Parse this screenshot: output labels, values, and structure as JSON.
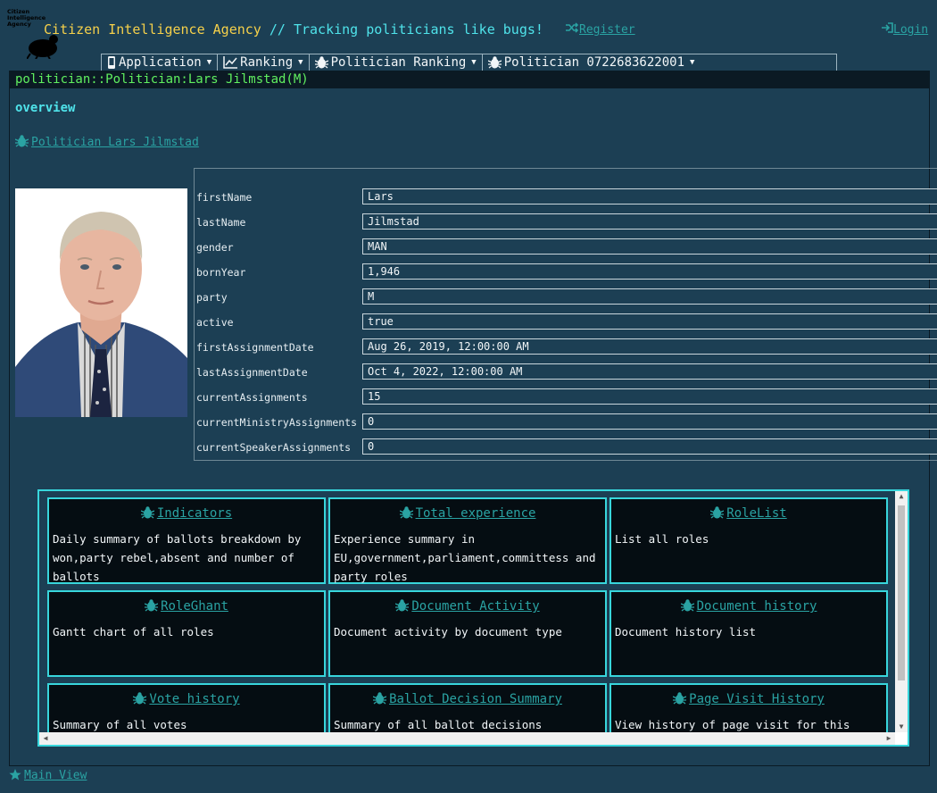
{
  "header": {
    "logo_text": "Citizen\nIntelligence\nAgency",
    "title_part1": "Citizen Intelligence Agency",
    "title_part2": " // Tracking politicians like bugs!",
    "register_label": "Register",
    "login_label": "Login"
  },
  "menu": [
    {
      "label": "Application",
      "icon": "phone-icon"
    },
    {
      "label": "Ranking",
      "icon": "line-chart-icon"
    },
    {
      "label": "Politician Ranking",
      "icon": "bug-icon"
    },
    {
      "label": "Politician 0722683622001",
      "icon": "bug-icon"
    }
  ],
  "page": {
    "title": "politician::Politician:Lars Jilmstad(M)",
    "section": "overview",
    "politician_link": "Politician Lars Jilmstad"
  },
  "attributes": [
    {
      "label": "firstName",
      "value": "Lars"
    },
    {
      "label": "lastName",
      "value": "Jilmstad"
    },
    {
      "label": "gender",
      "value": "MAN"
    },
    {
      "label": "bornYear",
      "value": "1,946"
    },
    {
      "label": "party",
      "value": "M"
    },
    {
      "label": "active",
      "value": "true"
    },
    {
      "label": "firstAssignmentDate",
      "value": "Aug 26, 2019, 12:00:00 AM"
    },
    {
      "label": "lastAssignmentDate",
      "value": "Oct 4, 2022, 12:00:00 AM"
    },
    {
      "label": "currentAssignments",
      "value": "15"
    },
    {
      "label": "currentMinistryAssignments",
      "value": "0"
    },
    {
      "label": "currentSpeakerAssignments",
      "value": "0"
    }
  ],
  "cards": [
    {
      "title": "Indicators",
      "desc": "Daily summary of ballots breakdown by won,party rebel,absent and number of ballots"
    },
    {
      "title": "Total experience",
      "desc": "Experience summary in EU,government,parliament,committess and party roles"
    },
    {
      "title": "RoleList",
      "desc": "List all roles"
    },
    {
      "title": "RoleGhant",
      "desc": "Gantt chart of all roles"
    },
    {
      "title": "Document Activity",
      "desc": "Document activity by document type"
    },
    {
      "title": "Document history",
      "desc": "Document history list"
    },
    {
      "title": "Vote history",
      "desc": "Summary of all votes"
    },
    {
      "title": "Ballot Decision Summary",
      "desc": "Summary of all ballot decisions"
    },
    {
      "title": "Page Visit History",
      "desc": "View history of page visit for this page."
    }
  ],
  "footer": {
    "main_view_label": "Main View"
  },
  "colors": {
    "background": "#1c3f54",
    "accent": "#2aa3a3",
    "title_yellow": "#f5d04a",
    "title_cyan": "#4fe3ea",
    "page_title_green": "#60f060",
    "card_border": "#38d6dc"
  }
}
